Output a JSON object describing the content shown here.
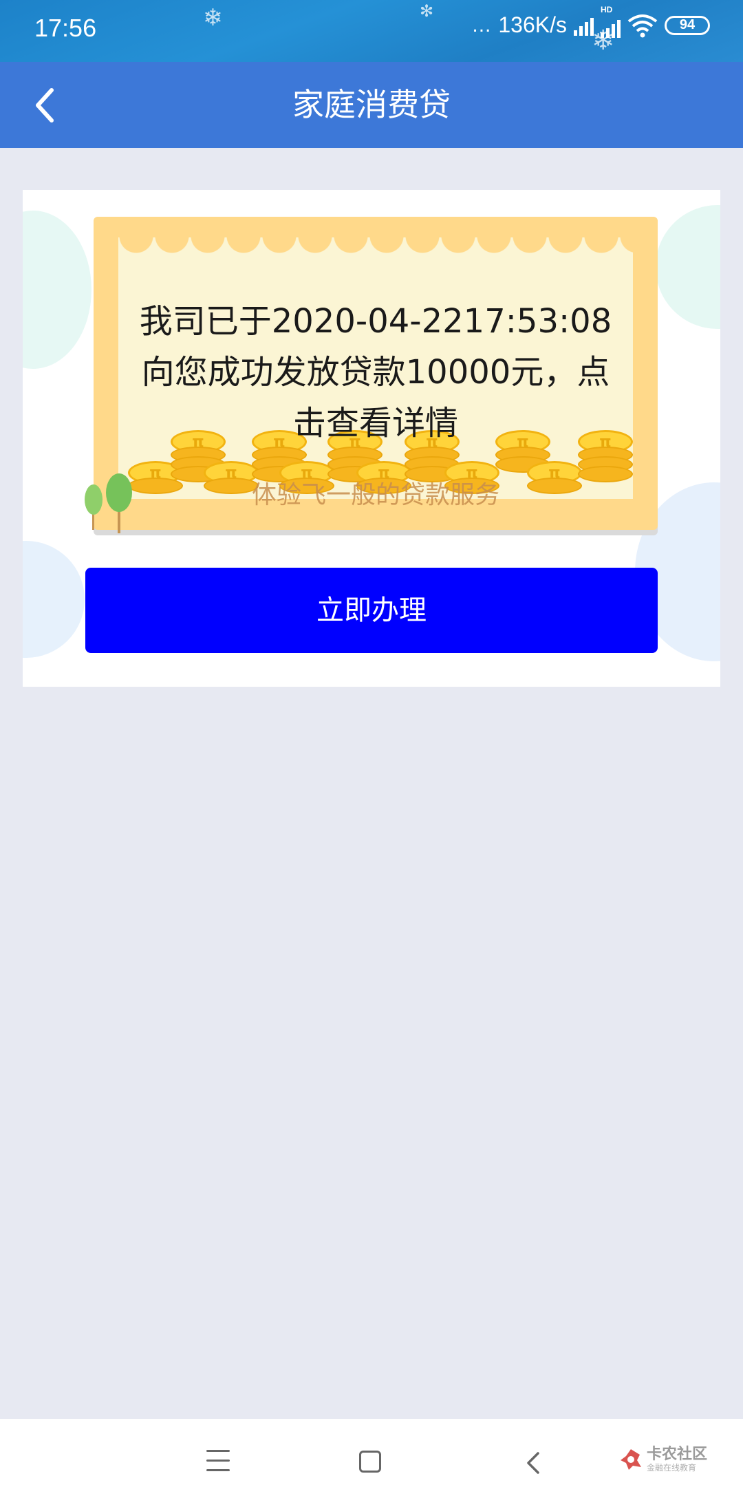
{
  "status_bar": {
    "time": "17:56",
    "dots": "...",
    "network_speed": "136K/s",
    "hd_label": "HD",
    "battery": "94"
  },
  "header": {
    "title": "家庭消费贷",
    "back_icon": "chevron-left-icon"
  },
  "banner": {
    "message": "我司已于2020-04-2217:53:08向您成功发放贷款10000元，点击查看详情",
    "subtitle": "体验飞一般的贷款服务",
    "coin_symbol": "π"
  },
  "apply_button": {
    "label": "立即办理",
    "color": "#0000ff"
  },
  "nav_bar": {
    "menu_icon": "menu-icon",
    "home_icon": "home-square-icon",
    "back_icon": "back-chevron-icon"
  },
  "watermark": {
    "name": "卡农社区",
    "subtitle": "金融在线教育"
  },
  "colors": {
    "header": "#3d78d8",
    "page_background": "#e7e9f2",
    "banner_frame": "#ffd98a",
    "banner_paper": "#fbf5d4"
  }
}
